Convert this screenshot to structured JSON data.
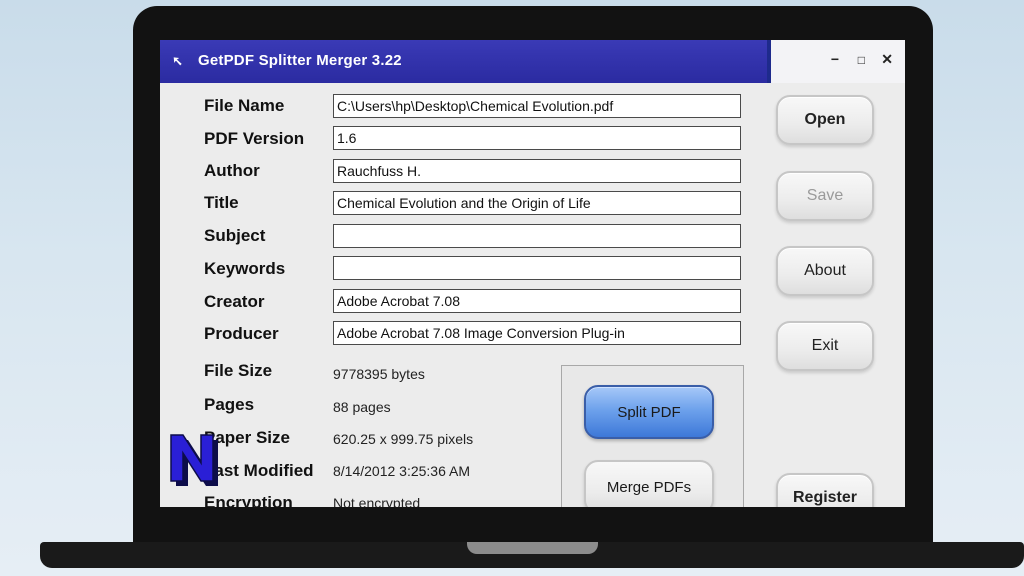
{
  "window": {
    "title": "GetPDF Splitter Merger 3.22",
    "controls": {
      "minimize": "−",
      "maximize": "□",
      "close": "✕"
    }
  },
  "fields": [
    {
      "label": "File Name",
      "value": "C:\\Users\\hp\\Desktop\\Chemical Evolution.pdf"
    },
    {
      "label": "PDF Version",
      "value": "1.6"
    },
    {
      "label": "Author",
      "value": "Rauchfuss H."
    },
    {
      "label": "Title",
      "value": "Chemical Evolution and the Origin of Life"
    },
    {
      "label": "Subject",
      "value": ""
    },
    {
      "label": "Keywords",
      "value": ""
    },
    {
      "label": "Creator",
      "value": "Adobe Acrobat 7.08"
    },
    {
      "label": "Producer",
      "value": "Adobe Acrobat 7.08 Image Conversion Plug-in"
    }
  ],
  "info": [
    {
      "label": "File Size",
      "value": "9778395 bytes"
    },
    {
      "label": "Pages",
      "value": "88 pages"
    },
    {
      "label": "Paper Size",
      "value": "620.25 x 999.75 pixels"
    },
    {
      "label": "Last Modified",
      "value": "8/14/2012 3:25:36 AM"
    },
    {
      "label": "Encryption",
      "value": "Not encrypted"
    }
  ],
  "buttons": {
    "open": "Open",
    "save": "Save",
    "about": "About",
    "exit": "Exit",
    "register": "Register",
    "split": "Split PDF",
    "merge": "Merge PDFs"
  },
  "watermark": {
    "letter": "N",
    "color": "#2a1fd6"
  }
}
